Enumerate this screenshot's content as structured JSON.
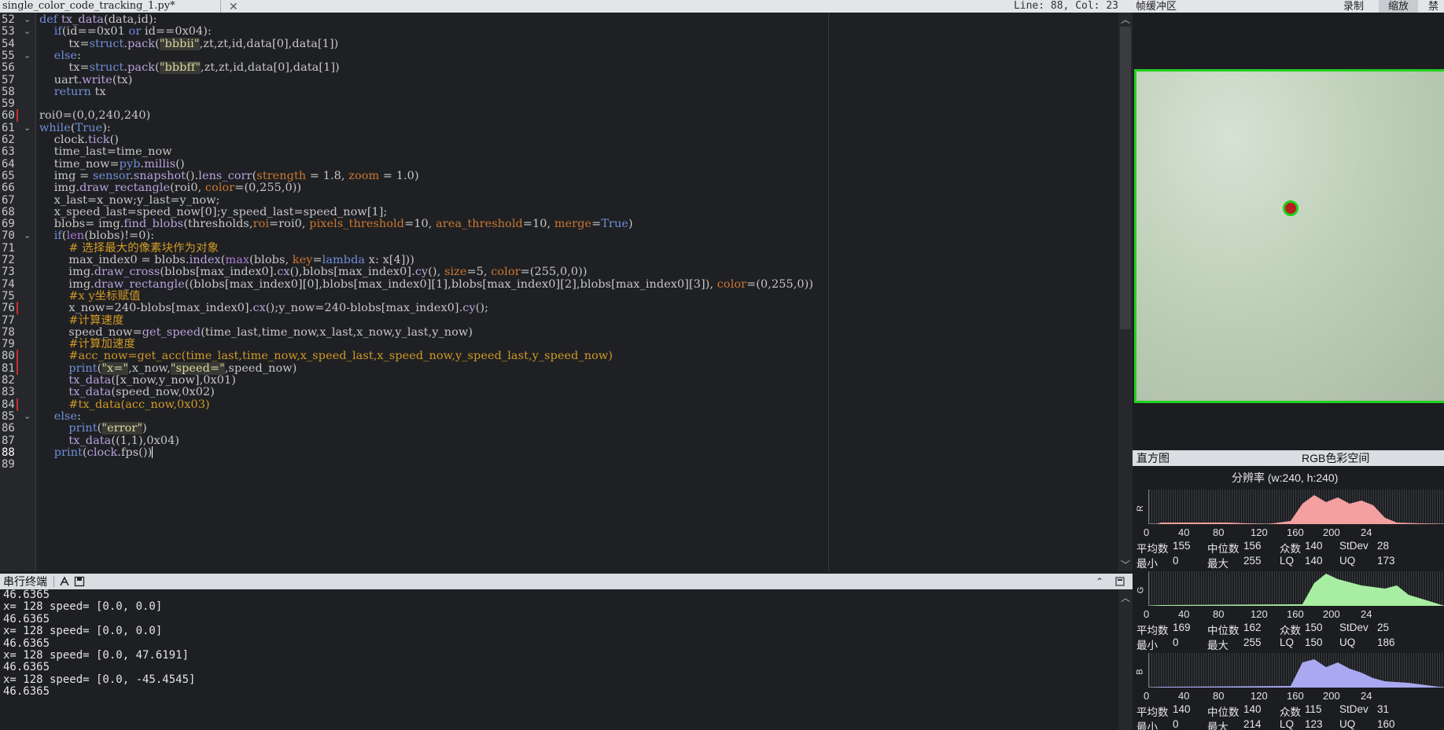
{
  "editor": {
    "file_tab": "single_color_code_tracking_1.py*",
    "close_glyph": "✕",
    "cursor_position": "Line: 88, Col: 23",
    "lines": [
      {
        "n": "52",
        "fold": true,
        "segs": [
          [
            "def ",
            "kw"
          ],
          [
            "tx_data",
            "fn"
          ],
          [
            "(data,id):",
            ""
          ]
        ]
      },
      {
        "n": "53",
        "fold": true,
        "segs": [
          [
            "    ",
            ""
          ],
          [
            "if",
            "kw"
          ],
          [
            "(id==",
            ""
          ],
          [
            "0x01",
            "nm"
          ],
          [
            " or ",
            "kw"
          ],
          [
            "id==",
            ""
          ],
          [
            "0x04",
            "nm"
          ],
          [
            "):",
            ""
          ]
        ]
      },
      {
        "n": "54",
        "segs": [
          [
            "        tx=",
            ""
          ],
          [
            "struct",
            "kw"
          ],
          [
            ".",
            ""
          ],
          [
            "pack",
            "fn"
          ],
          [
            "(",
            ""
          ],
          [
            "\"bbbii\"",
            "str"
          ],
          [
            ",zt,zt,id,data[0],data[1])",
            ""
          ]
        ]
      },
      {
        "n": "55",
        "fold": true,
        "segs": [
          [
            "    ",
            ""
          ],
          [
            "else",
            "kw"
          ],
          [
            ":",
            ""
          ]
        ]
      },
      {
        "n": "56",
        "segs": [
          [
            "        tx=",
            ""
          ],
          [
            "struct",
            "kw"
          ],
          [
            ".",
            ""
          ],
          [
            "pack",
            "fn"
          ],
          [
            "(",
            ""
          ],
          [
            "\"bbbff\"",
            "str"
          ],
          [
            ",zt,zt,id,data[0],data[1])",
            ""
          ]
        ]
      },
      {
        "n": "57",
        "segs": [
          [
            "    uart.",
            ""
          ],
          [
            "write",
            "fn"
          ],
          [
            "(tx)",
            ""
          ]
        ]
      },
      {
        "n": "58",
        "segs": [
          [
            "    ",
            ""
          ],
          [
            "return",
            "kw"
          ],
          [
            " tx",
            ""
          ]
        ]
      },
      {
        "n": "59",
        "segs": []
      },
      {
        "n": "60",
        "mark": true,
        "segs": [
          [
            "roi0=(0,0,240,240)",
            ""
          ]
        ]
      },
      {
        "n": "61",
        "fold": true,
        "segs": [
          [
            "while",
            "kw"
          ],
          [
            "(",
            ""
          ],
          [
            "True",
            "kw"
          ],
          [
            "):",
            ""
          ]
        ]
      },
      {
        "n": "62",
        "segs": [
          [
            "    clock.",
            ""
          ],
          [
            "tick",
            "fn"
          ],
          [
            "()",
            ""
          ]
        ]
      },
      {
        "n": "63",
        "segs": [
          [
            "    time_last=time_now",
            ""
          ]
        ]
      },
      {
        "n": "64",
        "segs": [
          [
            "    time_now=",
            ""
          ],
          [
            "pyb",
            "kw"
          ],
          [
            ".",
            ""
          ],
          [
            "millis",
            "fn"
          ],
          [
            "()",
            ""
          ]
        ]
      },
      {
        "n": "65",
        "segs": [
          [
            "    img = ",
            ""
          ],
          [
            "sensor",
            "kw"
          ],
          [
            ".",
            ""
          ],
          [
            "snapshot",
            "fn"
          ],
          [
            "().",
            ""
          ],
          [
            "lens_corr",
            "fn"
          ],
          [
            "(",
            ""
          ],
          [
            "strength",
            "kwa"
          ],
          [
            " = 1.8, ",
            ""
          ],
          [
            "zoom",
            "kwa"
          ],
          [
            " = 1.0)",
            ""
          ]
        ]
      },
      {
        "n": "66",
        "segs": [
          [
            "    img.",
            ""
          ],
          [
            "draw_rectangle",
            "fn"
          ],
          [
            "(roi0, ",
            ""
          ],
          [
            "color",
            "kwa"
          ],
          [
            "=(0,255,0))",
            ""
          ]
        ]
      },
      {
        "n": "67",
        "segs": [
          [
            "    x_last=x_now;y_last=y_now;",
            ""
          ]
        ]
      },
      {
        "n": "68",
        "segs": [
          [
            "    x_speed_last=speed_now[0];y_speed_last=speed_now[1];",
            ""
          ]
        ]
      },
      {
        "n": "69",
        "segs": [
          [
            "    blobs= img.",
            ""
          ],
          [
            "find_blobs",
            "fn"
          ],
          [
            "(thresholds,",
            ""
          ],
          [
            "roi",
            "kwa"
          ],
          [
            "=roi0, ",
            ""
          ],
          [
            "pixels_threshold",
            "kwa"
          ],
          [
            "=10, ",
            ""
          ],
          [
            "area_threshold",
            "kwa"
          ],
          [
            "=10, ",
            ""
          ],
          [
            "merge",
            "kwa"
          ],
          [
            "=",
            ""
          ],
          [
            "True",
            "kw"
          ],
          [
            ")",
            ""
          ]
        ]
      },
      {
        "n": "70",
        "fold": true,
        "segs": [
          [
            "    ",
            ""
          ],
          [
            "if",
            "kw"
          ],
          [
            "(",
            ""
          ],
          [
            "len",
            "mt"
          ],
          [
            "(blobs)!=0):",
            ""
          ]
        ]
      },
      {
        "n": "71",
        "segs": [
          [
            "        # 选择最大的像素块作为对象",
            "cm"
          ]
        ]
      },
      {
        "n": "72",
        "segs": [
          [
            "        max_index0 = blobs.",
            ""
          ],
          [
            "index",
            "fn"
          ],
          [
            "(",
            ""
          ],
          [
            "max",
            "mt"
          ],
          [
            "(blobs, ",
            ""
          ],
          [
            "key",
            "kwa"
          ],
          [
            "=",
            ""
          ],
          [
            "lambda",
            "kw"
          ],
          [
            " x: x[4]))",
            ""
          ]
        ]
      },
      {
        "n": "73",
        "segs": [
          [
            "        img.",
            ""
          ],
          [
            "draw_cross",
            "fn"
          ],
          [
            "(blobs[max_index0].",
            ""
          ],
          [
            "cx",
            "fn"
          ],
          [
            "(),blobs[max_index0].",
            ""
          ],
          [
            "cy",
            "fn"
          ],
          [
            "(), ",
            ""
          ],
          [
            "size",
            "kwa"
          ],
          [
            "=5, ",
            ""
          ],
          [
            "color",
            "kwa"
          ],
          [
            "=(255,0,0))",
            ""
          ]
        ]
      },
      {
        "n": "74",
        "segs": [
          [
            "        img.",
            ""
          ],
          [
            "draw_rectangle",
            "fn"
          ],
          [
            "((blobs[max_index0][0],blobs[max_index0][1],blobs[max_index0][2],blobs[max_index0][3]), ",
            ""
          ],
          [
            "color",
            "kwa"
          ],
          [
            "=(0,255,0))",
            ""
          ]
        ]
      },
      {
        "n": "75",
        "segs": [
          [
            "        #x y坐标赋值",
            "cm"
          ]
        ]
      },
      {
        "n": "76",
        "mark": true,
        "segs": [
          [
            "        x_now=240-blobs[max_index0].",
            ""
          ],
          [
            "cx",
            "fn"
          ],
          [
            "();y_now=240-blobs[max_index0].",
            ""
          ],
          [
            "cy",
            "fn"
          ],
          [
            "();",
            ""
          ]
        ]
      },
      {
        "n": "77",
        "segs": [
          [
            "        #计算速度",
            "cm"
          ]
        ]
      },
      {
        "n": "78",
        "segs": [
          [
            "        speed_now=",
            ""
          ],
          [
            "get_speed",
            "fn"
          ],
          [
            "(time_last,time_now,x_last,x_now,y_last,y_now)",
            ""
          ]
        ]
      },
      {
        "n": "79",
        "segs": [
          [
            "        #计算加速度",
            "cm"
          ]
        ]
      },
      {
        "n": "80",
        "mark": true,
        "segs": [
          [
            "        #acc_now=get_acc(time_last,time_now,x_speed_last,x_speed_now,y_speed_last,y_speed_now)",
            "cm"
          ]
        ]
      },
      {
        "n": "81",
        "mark": true,
        "segs": [
          [
            "        ",
            ""
          ],
          [
            "print",
            "kw"
          ],
          [
            "(",
            ""
          ],
          [
            "\"x=\"",
            "str"
          ],
          [
            ",x_now,",
            ""
          ],
          [
            "\"speed=\"",
            "str"
          ],
          [
            ",speed_now)",
            ""
          ]
        ]
      },
      {
        "n": "82",
        "segs": [
          [
            "        ",
            ""
          ],
          [
            "tx_data",
            "fn"
          ],
          [
            "([x_now,y_now],0x01)",
            ""
          ]
        ]
      },
      {
        "n": "83",
        "segs": [
          [
            "        ",
            ""
          ],
          [
            "tx_data",
            "fn"
          ],
          [
            "(speed_now,0x02)",
            ""
          ]
        ]
      },
      {
        "n": "84",
        "mark": true,
        "segs": [
          [
            "        #tx_data(acc_now,0x03)",
            "cm"
          ]
        ]
      },
      {
        "n": "85",
        "fold": true,
        "segs": [
          [
            "    ",
            ""
          ],
          [
            "else",
            "kw"
          ],
          [
            ":",
            ""
          ]
        ]
      },
      {
        "n": "86",
        "segs": [
          [
            "        ",
            ""
          ],
          [
            "print",
            "kw"
          ],
          [
            "(",
            ""
          ],
          [
            "\"error\"",
            "str"
          ],
          [
            ")",
            ""
          ]
        ]
      },
      {
        "n": "87",
        "segs": [
          [
            "        ",
            ""
          ],
          [
            "tx_data",
            "fn"
          ],
          [
            "((1,1),0x04)",
            ""
          ]
        ]
      },
      {
        "n": "88",
        "cur": true,
        "segs": [
          [
            "    ",
            ""
          ],
          [
            "print",
            "kw"
          ],
          [
            "(",
            ""
          ],
          [
            "clock",
            "fn"
          ],
          [
            ".fps())",
            ""
          ]
        ]
      },
      {
        "n": "89",
        "segs": []
      }
    ]
  },
  "serial": {
    "title": "串行终端",
    "lines": [
      "46.6365",
      "x= 128 speed= [0.0, 0.0]",
      "46.6365",
      "x= 128 speed= [0.0, 0.0]",
      "46.6365",
      "x= 128 speed= [0.0, 47.6191]",
      "46.6365",
      "x= 128 speed= [0.0, -45.4545]",
      "46.6365"
    ]
  },
  "framebuffer": {
    "title": "帧缓冲区",
    "record": "录制",
    "zoom": "缩放",
    "disable": "禁用",
    "accent": "#22d022"
  },
  "histogram": {
    "title": "直方图",
    "color_space": "RGB色彩空间",
    "resolution": "分辨率 (w:240, h:240)",
    "ticks": [
      "0",
      "40",
      "80",
      "120",
      "160",
      "200",
      "24"
    ],
    "labels": {
      "mean": "平均数",
      "median": "中位数",
      "mode": "众数",
      "stdev": "StDev",
      "min": "最小",
      "max": "最大",
      "lq": "LQ",
      "uq": "UQ"
    },
    "channels": [
      {
        "letter": "R",
        "color": "#f4a0a0",
        "mean": "155",
        "median": "156",
        "mode": "140",
        "stdev": "28",
        "min": "0",
        "max": "255",
        "lq": "140",
        "uq": "173"
      },
      {
        "letter": "G",
        "color": "#a7eea3",
        "mean": "169",
        "median": "162",
        "mode": "150",
        "stdev": "25",
        "min": "0",
        "max": "255",
        "lq": "150",
        "uq": "186"
      },
      {
        "letter": "B",
        "color": "#a9a8f1",
        "mean": "140",
        "median": "140",
        "mode": "115",
        "stdev": "31",
        "min": "0",
        "max": "214",
        "lq": "123",
        "uq": "160"
      }
    ]
  }
}
